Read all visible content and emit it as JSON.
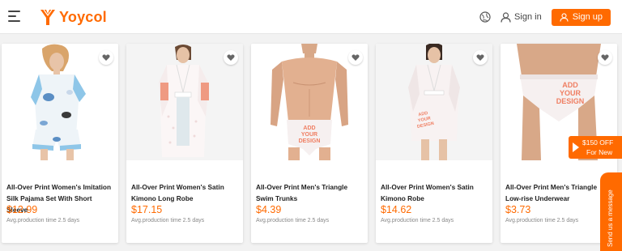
{
  "header": {
    "brand": "Yoycol",
    "signin_label": "Sign in",
    "signup_label": "Sign up",
    "icons": [
      "menu-icon",
      "logo-icon",
      "globe-icon",
      "user-icon"
    ]
  },
  "products": [
    {
      "title": "All-Over Print Women's Imitation Silk Pajama Set With Short Sleeve",
      "price": "$12.99",
      "production": "Avg.production time 2.5 days"
    },
    {
      "title": "All-Over Print Women's Satin Kimono Long Robe",
      "price": "$17.15",
      "production": "Avg.production time 2.5 days"
    },
    {
      "title": "All-Over Print Men's Triangle Swim Trunks",
      "price": "$4.39",
      "production": "Avg.production time 2.5 days"
    },
    {
      "title": "All-Over Print Women's Satin Kimono Robe",
      "price": "$14.62",
      "production": "Avg.production time 2.5 days"
    },
    {
      "title": "All-Over Print Men's Triangle Low-rise Underwear",
      "price": "$3.73",
      "production": "Avg.production time 2.5 days"
    }
  ],
  "design_text": [
    "ADD",
    "YOUR",
    "DESIGN"
  ],
  "promo": {
    "line1": "$150 OFF",
    "line2": "For New"
  },
  "send_message": "Send us a message",
  "colors": {
    "accent": "#ff6a00",
    "background": "#f2f2f2"
  }
}
